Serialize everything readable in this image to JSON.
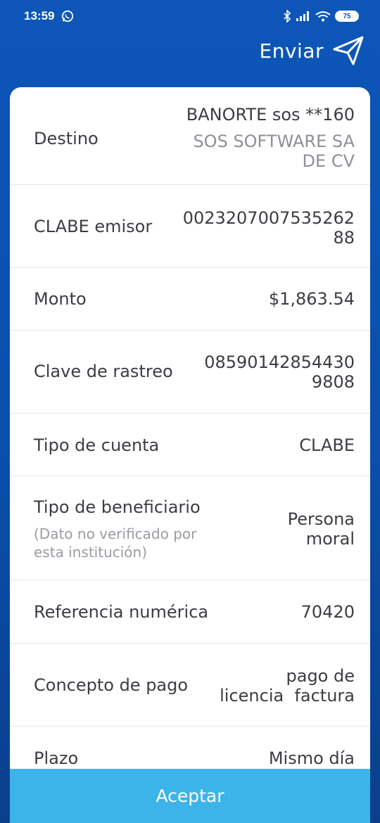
{
  "status_bar": {
    "time": "13:59",
    "battery": "75"
  },
  "header": {
    "send_label": "Enviar"
  },
  "details": {
    "destino": {
      "label": "Destino",
      "value_line1": "BANORTE sos **160",
      "value_line2": "SOS SOFTWARE SA",
      "value_line3": "DE CV"
    },
    "clabe_emisor": {
      "label": "CLABE emisor",
      "value_line1": "0023207007535262",
      "value_line2": "88"
    },
    "monto": {
      "label": "Monto",
      "value": "$1,863.54"
    },
    "clave_rastreo": {
      "label": "Clave de rastreo",
      "value_line1": "08590142854430",
      "value_line2": "9808"
    },
    "tipo_cuenta": {
      "label": "Tipo de cuenta",
      "value": "CLABE"
    },
    "tipo_beneficiario": {
      "label": "Tipo de beneficiario",
      "sublabel_line1": "(Dato no verificado por",
      "sublabel_line2": "esta institución)",
      "value_line1": "Persona",
      "value_line2": "moral"
    },
    "referencia": {
      "label": "Referencia numérica",
      "value": "70420"
    },
    "concepto": {
      "label": "Concepto de pago",
      "value_line1": "pago de",
      "value_line2": "licencia  factura"
    },
    "plazo": {
      "label": "Plazo",
      "value": "Mismo día"
    }
  },
  "footer": {
    "accept_label": "Aceptar"
  },
  "colors": {
    "header_blue": "#0d56b8",
    "accept_button": "#3bb4ea"
  }
}
